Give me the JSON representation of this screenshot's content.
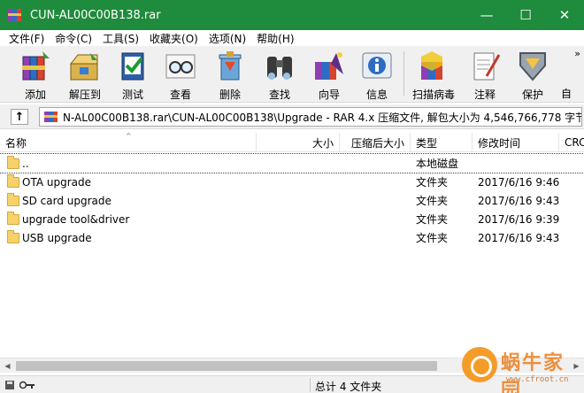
{
  "window": {
    "title": "CUN-AL00C00B138.rar",
    "minimize": "—",
    "maximize": "☐",
    "close": "✕"
  },
  "menu": [
    "文件(F)",
    "命令(C)",
    "工具(S)",
    "收藏夹(O)",
    "选项(N)",
    "帮助(H)"
  ],
  "toolbar": [
    {
      "label": "添加",
      "icon": "add-books-icon"
    },
    {
      "label": "解压到",
      "icon": "extract-icon"
    },
    {
      "label": "测试",
      "icon": "test-icon"
    },
    {
      "label": "查看",
      "icon": "view-glasses-icon"
    },
    {
      "label": "删除",
      "icon": "delete-recycle-icon"
    },
    {
      "label": "查找",
      "icon": "find-binoculars-icon"
    },
    {
      "label": "向导",
      "icon": "wizard-icon"
    },
    {
      "label": "信息",
      "icon": "info-icon"
    },
    {
      "label": "扫描病毒",
      "icon": "virus-scan-icon"
    },
    {
      "label": "注释",
      "icon": "comment-icon"
    },
    {
      "label": "保护",
      "icon": "protect-shield-icon"
    },
    {
      "label": "自",
      "icon": "sfx-icon"
    }
  ],
  "toolbar_more": "»",
  "address": {
    "up": "↑",
    "path": "N-AL00C00B138.rar\\CUN-AL00C00B138\\Upgrade - RAR 4.x 压缩文件, 解包大小为 4,546,766,778 字节"
  },
  "columns": [
    "名称",
    "大小",
    "压缩后大小",
    "类型",
    "修改时间",
    "CRC"
  ],
  "sort_indicator": "^",
  "files": [
    {
      "name": "..",
      "type": "本地磁盘",
      "modified": ""
    },
    {
      "name": "OTA upgrade",
      "type": "文件夹",
      "modified": "2017/6/16 9:46"
    },
    {
      "name": "SD card upgrade",
      "type": "文件夹",
      "modified": "2017/6/16 9:43"
    },
    {
      "name": "upgrade tool&driver",
      "type": "文件夹",
      "modified": "2017/6/16 9:39"
    },
    {
      "name": "USB upgrade",
      "type": "文件夹",
      "modified": "2017/6/16 9:43"
    }
  ],
  "scroll": {
    "left": "◀",
    "right": "▶"
  },
  "status": {
    "text": "总计 4 文件夹"
  },
  "watermark": {
    "text": "蜗牛家园",
    "url": "www.cfroot.cn"
  },
  "colors": {
    "titlebar": "#1f8b3c",
    "selection_outline": "#444444"
  }
}
